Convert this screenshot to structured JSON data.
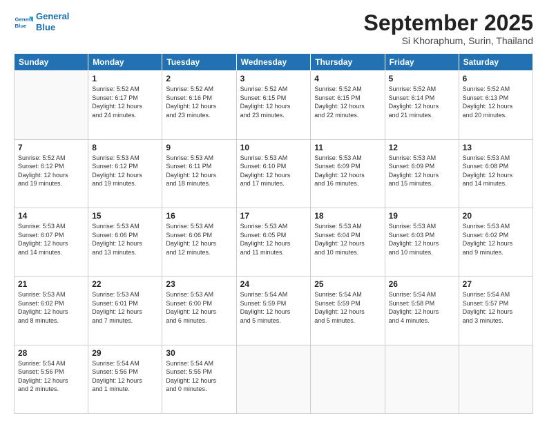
{
  "header": {
    "logo_line1": "General",
    "logo_line2": "Blue",
    "month": "September 2025",
    "location": "Si Khoraphum, Surin, Thailand"
  },
  "weekdays": [
    "Sunday",
    "Monday",
    "Tuesday",
    "Wednesday",
    "Thursday",
    "Friday",
    "Saturday"
  ],
  "weeks": [
    [
      {
        "day": "",
        "detail": ""
      },
      {
        "day": "1",
        "detail": "Sunrise: 5:52 AM\nSunset: 6:17 PM\nDaylight: 12 hours\nand 24 minutes."
      },
      {
        "day": "2",
        "detail": "Sunrise: 5:52 AM\nSunset: 6:16 PM\nDaylight: 12 hours\nand 23 minutes."
      },
      {
        "day": "3",
        "detail": "Sunrise: 5:52 AM\nSunset: 6:15 PM\nDaylight: 12 hours\nand 23 minutes."
      },
      {
        "day": "4",
        "detail": "Sunrise: 5:52 AM\nSunset: 6:15 PM\nDaylight: 12 hours\nand 22 minutes."
      },
      {
        "day": "5",
        "detail": "Sunrise: 5:52 AM\nSunset: 6:14 PM\nDaylight: 12 hours\nand 21 minutes."
      },
      {
        "day": "6",
        "detail": "Sunrise: 5:52 AM\nSunset: 6:13 PM\nDaylight: 12 hours\nand 20 minutes."
      }
    ],
    [
      {
        "day": "7",
        "detail": "Sunrise: 5:52 AM\nSunset: 6:12 PM\nDaylight: 12 hours\nand 19 minutes."
      },
      {
        "day": "8",
        "detail": "Sunrise: 5:53 AM\nSunset: 6:12 PM\nDaylight: 12 hours\nand 19 minutes."
      },
      {
        "day": "9",
        "detail": "Sunrise: 5:53 AM\nSunset: 6:11 PM\nDaylight: 12 hours\nand 18 minutes."
      },
      {
        "day": "10",
        "detail": "Sunrise: 5:53 AM\nSunset: 6:10 PM\nDaylight: 12 hours\nand 17 minutes."
      },
      {
        "day": "11",
        "detail": "Sunrise: 5:53 AM\nSunset: 6:09 PM\nDaylight: 12 hours\nand 16 minutes."
      },
      {
        "day": "12",
        "detail": "Sunrise: 5:53 AM\nSunset: 6:09 PM\nDaylight: 12 hours\nand 15 minutes."
      },
      {
        "day": "13",
        "detail": "Sunrise: 5:53 AM\nSunset: 6:08 PM\nDaylight: 12 hours\nand 14 minutes."
      }
    ],
    [
      {
        "day": "14",
        "detail": "Sunrise: 5:53 AM\nSunset: 6:07 PM\nDaylight: 12 hours\nand 14 minutes."
      },
      {
        "day": "15",
        "detail": "Sunrise: 5:53 AM\nSunset: 6:06 PM\nDaylight: 12 hours\nand 13 minutes."
      },
      {
        "day": "16",
        "detail": "Sunrise: 5:53 AM\nSunset: 6:06 PM\nDaylight: 12 hours\nand 12 minutes."
      },
      {
        "day": "17",
        "detail": "Sunrise: 5:53 AM\nSunset: 6:05 PM\nDaylight: 12 hours\nand 11 minutes."
      },
      {
        "day": "18",
        "detail": "Sunrise: 5:53 AM\nSunset: 6:04 PM\nDaylight: 12 hours\nand 10 minutes."
      },
      {
        "day": "19",
        "detail": "Sunrise: 5:53 AM\nSunset: 6:03 PM\nDaylight: 12 hours\nand 10 minutes."
      },
      {
        "day": "20",
        "detail": "Sunrise: 5:53 AM\nSunset: 6:02 PM\nDaylight: 12 hours\nand 9 minutes."
      }
    ],
    [
      {
        "day": "21",
        "detail": "Sunrise: 5:53 AM\nSunset: 6:02 PM\nDaylight: 12 hours\nand 8 minutes."
      },
      {
        "day": "22",
        "detail": "Sunrise: 5:53 AM\nSunset: 6:01 PM\nDaylight: 12 hours\nand 7 minutes."
      },
      {
        "day": "23",
        "detail": "Sunrise: 5:53 AM\nSunset: 6:00 PM\nDaylight: 12 hours\nand 6 minutes."
      },
      {
        "day": "24",
        "detail": "Sunrise: 5:54 AM\nSunset: 5:59 PM\nDaylight: 12 hours\nand 5 minutes."
      },
      {
        "day": "25",
        "detail": "Sunrise: 5:54 AM\nSunset: 5:59 PM\nDaylight: 12 hours\nand 5 minutes."
      },
      {
        "day": "26",
        "detail": "Sunrise: 5:54 AM\nSunset: 5:58 PM\nDaylight: 12 hours\nand 4 minutes."
      },
      {
        "day": "27",
        "detail": "Sunrise: 5:54 AM\nSunset: 5:57 PM\nDaylight: 12 hours\nand 3 minutes."
      }
    ],
    [
      {
        "day": "28",
        "detail": "Sunrise: 5:54 AM\nSunset: 5:56 PM\nDaylight: 12 hours\nand 2 minutes."
      },
      {
        "day": "29",
        "detail": "Sunrise: 5:54 AM\nSunset: 5:56 PM\nDaylight: 12 hours\nand 1 minute."
      },
      {
        "day": "30",
        "detail": "Sunrise: 5:54 AM\nSunset: 5:55 PM\nDaylight: 12 hours\nand 0 minutes."
      },
      {
        "day": "",
        "detail": ""
      },
      {
        "day": "",
        "detail": ""
      },
      {
        "day": "",
        "detail": ""
      },
      {
        "day": "",
        "detail": ""
      }
    ]
  ]
}
